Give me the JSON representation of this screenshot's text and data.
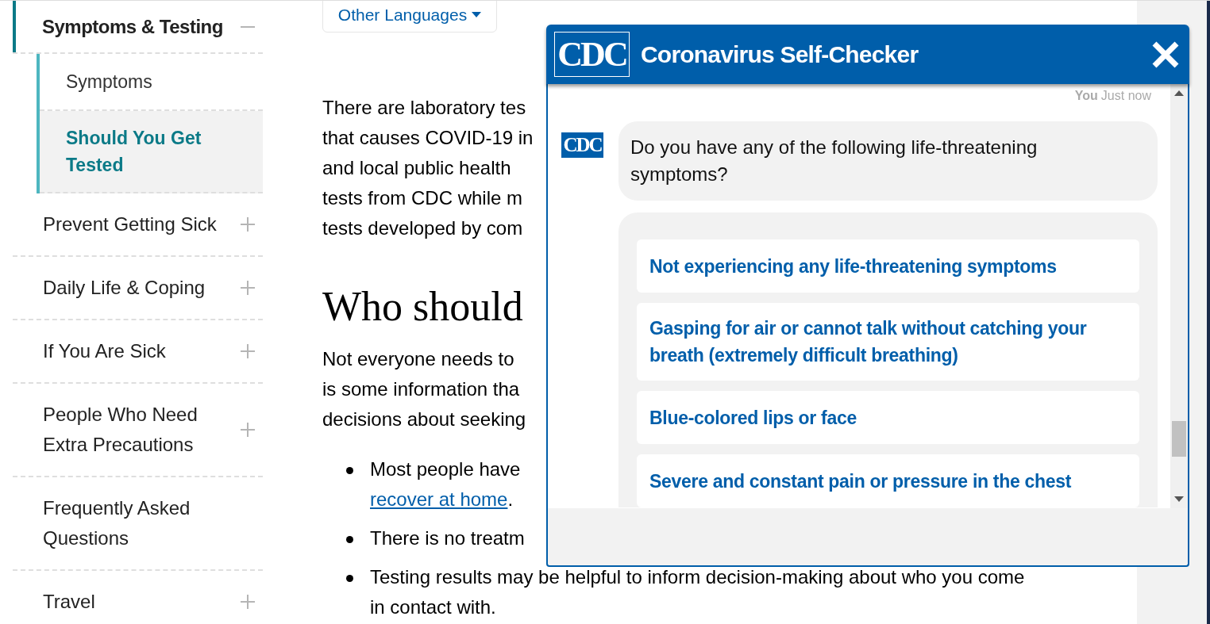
{
  "sidebar": {
    "items": [
      {
        "label": "Symptoms & Testing",
        "expanded": true,
        "children": [
          {
            "label": "Symptoms",
            "selected": false
          },
          {
            "label": "Should You Get Tested",
            "selected": true
          }
        ]
      },
      {
        "label": "Prevent Getting Sick",
        "expanded": false
      },
      {
        "label": "Daily Life & Coping",
        "expanded": false
      },
      {
        "label": "If You Are Sick",
        "expanded": false
      },
      {
        "label": "People Who Need Extra Precautions",
        "expanded": false
      },
      {
        "label": "Frequently Asked Questions"
      },
      {
        "label": "Travel",
        "expanded": false
      }
    ]
  },
  "main": {
    "language_button": {
      "label": "Other Languages"
    },
    "intro_lines": [
      "There are laboratory tes",
      "that causes COVID-19 in",
      "and local public health",
      "tests from CDC while m",
      "tests developed by com"
    ],
    "heading": "Who should",
    "paragraph_lines": [
      "Not everyone needs to",
      "is some information tha",
      "decisions about seeking"
    ],
    "bullets": [
      {
        "lines": [
          [
            {
              "text": "Most people have",
              "link": false
            }
          ],
          [
            {
              "text": "recover at home",
              "link": true
            },
            {
              "text": ".",
              "link": false
            }
          ]
        ]
      },
      {
        "lines": [
          [
            {
              "text": "There is no treatm",
              "link": false
            }
          ]
        ]
      },
      {
        "lines": [
          [
            {
              "text": "Testing results may be helpful to inform decision-making about who you come",
              "link": false
            }
          ],
          [
            {
              "text": "in contact with.",
              "link": false
            }
          ]
        ]
      }
    ]
  },
  "chat": {
    "logo": "CDC",
    "title": "Coronavirus Self-Checker",
    "meta": {
      "sender": "You",
      "time": "Just now"
    },
    "avatar": "CDC",
    "message": "Do you have any of the following life-threatening symptoms?",
    "options": [
      "Not experiencing any life-threatening symptoms",
      "Gasping for air or cannot talk without catching your breath (extremely difficult breathing)",
      "Blue-colored lips or face",
      "Severe and constant pain or pressure in the chest"
    ]
  }
}
